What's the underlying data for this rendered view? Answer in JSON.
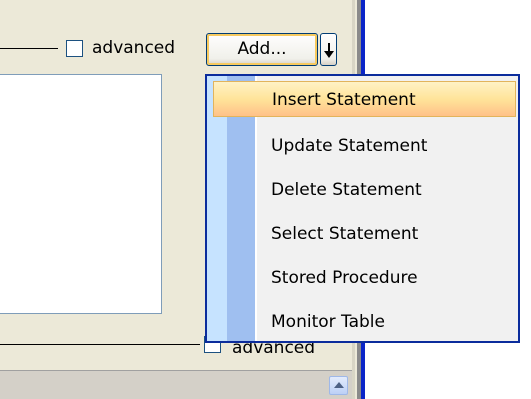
{
  "toolbar": {
    "advanced_label": "advanced",
    "add_button_label": "Add..."
  },
  "bottom": {
    "advanced_label": "advanced"
  },
  "menu": {
    "items": [
      {
        "label": "Insert Statement",
        "highlighted": true
      },
      {
        "label": "Update Statement"
      },
      {
        "label": "Delete Statement"
      },
      {
        "label": "Select Statement"
      },
      {
        "label": "Stored Procedure"
      },
      {
        "label": "Monitor Table"
      }
    ]
  },
  "icons": [
    "chevron-down-icon",
    "scroll-up-arrow-icon"
  ],
  "colors": {
    "panel": "#ece9d8",
    "menu_border": "#0b2c9c",
    "highlight": "#ffe49a"
  }
}
